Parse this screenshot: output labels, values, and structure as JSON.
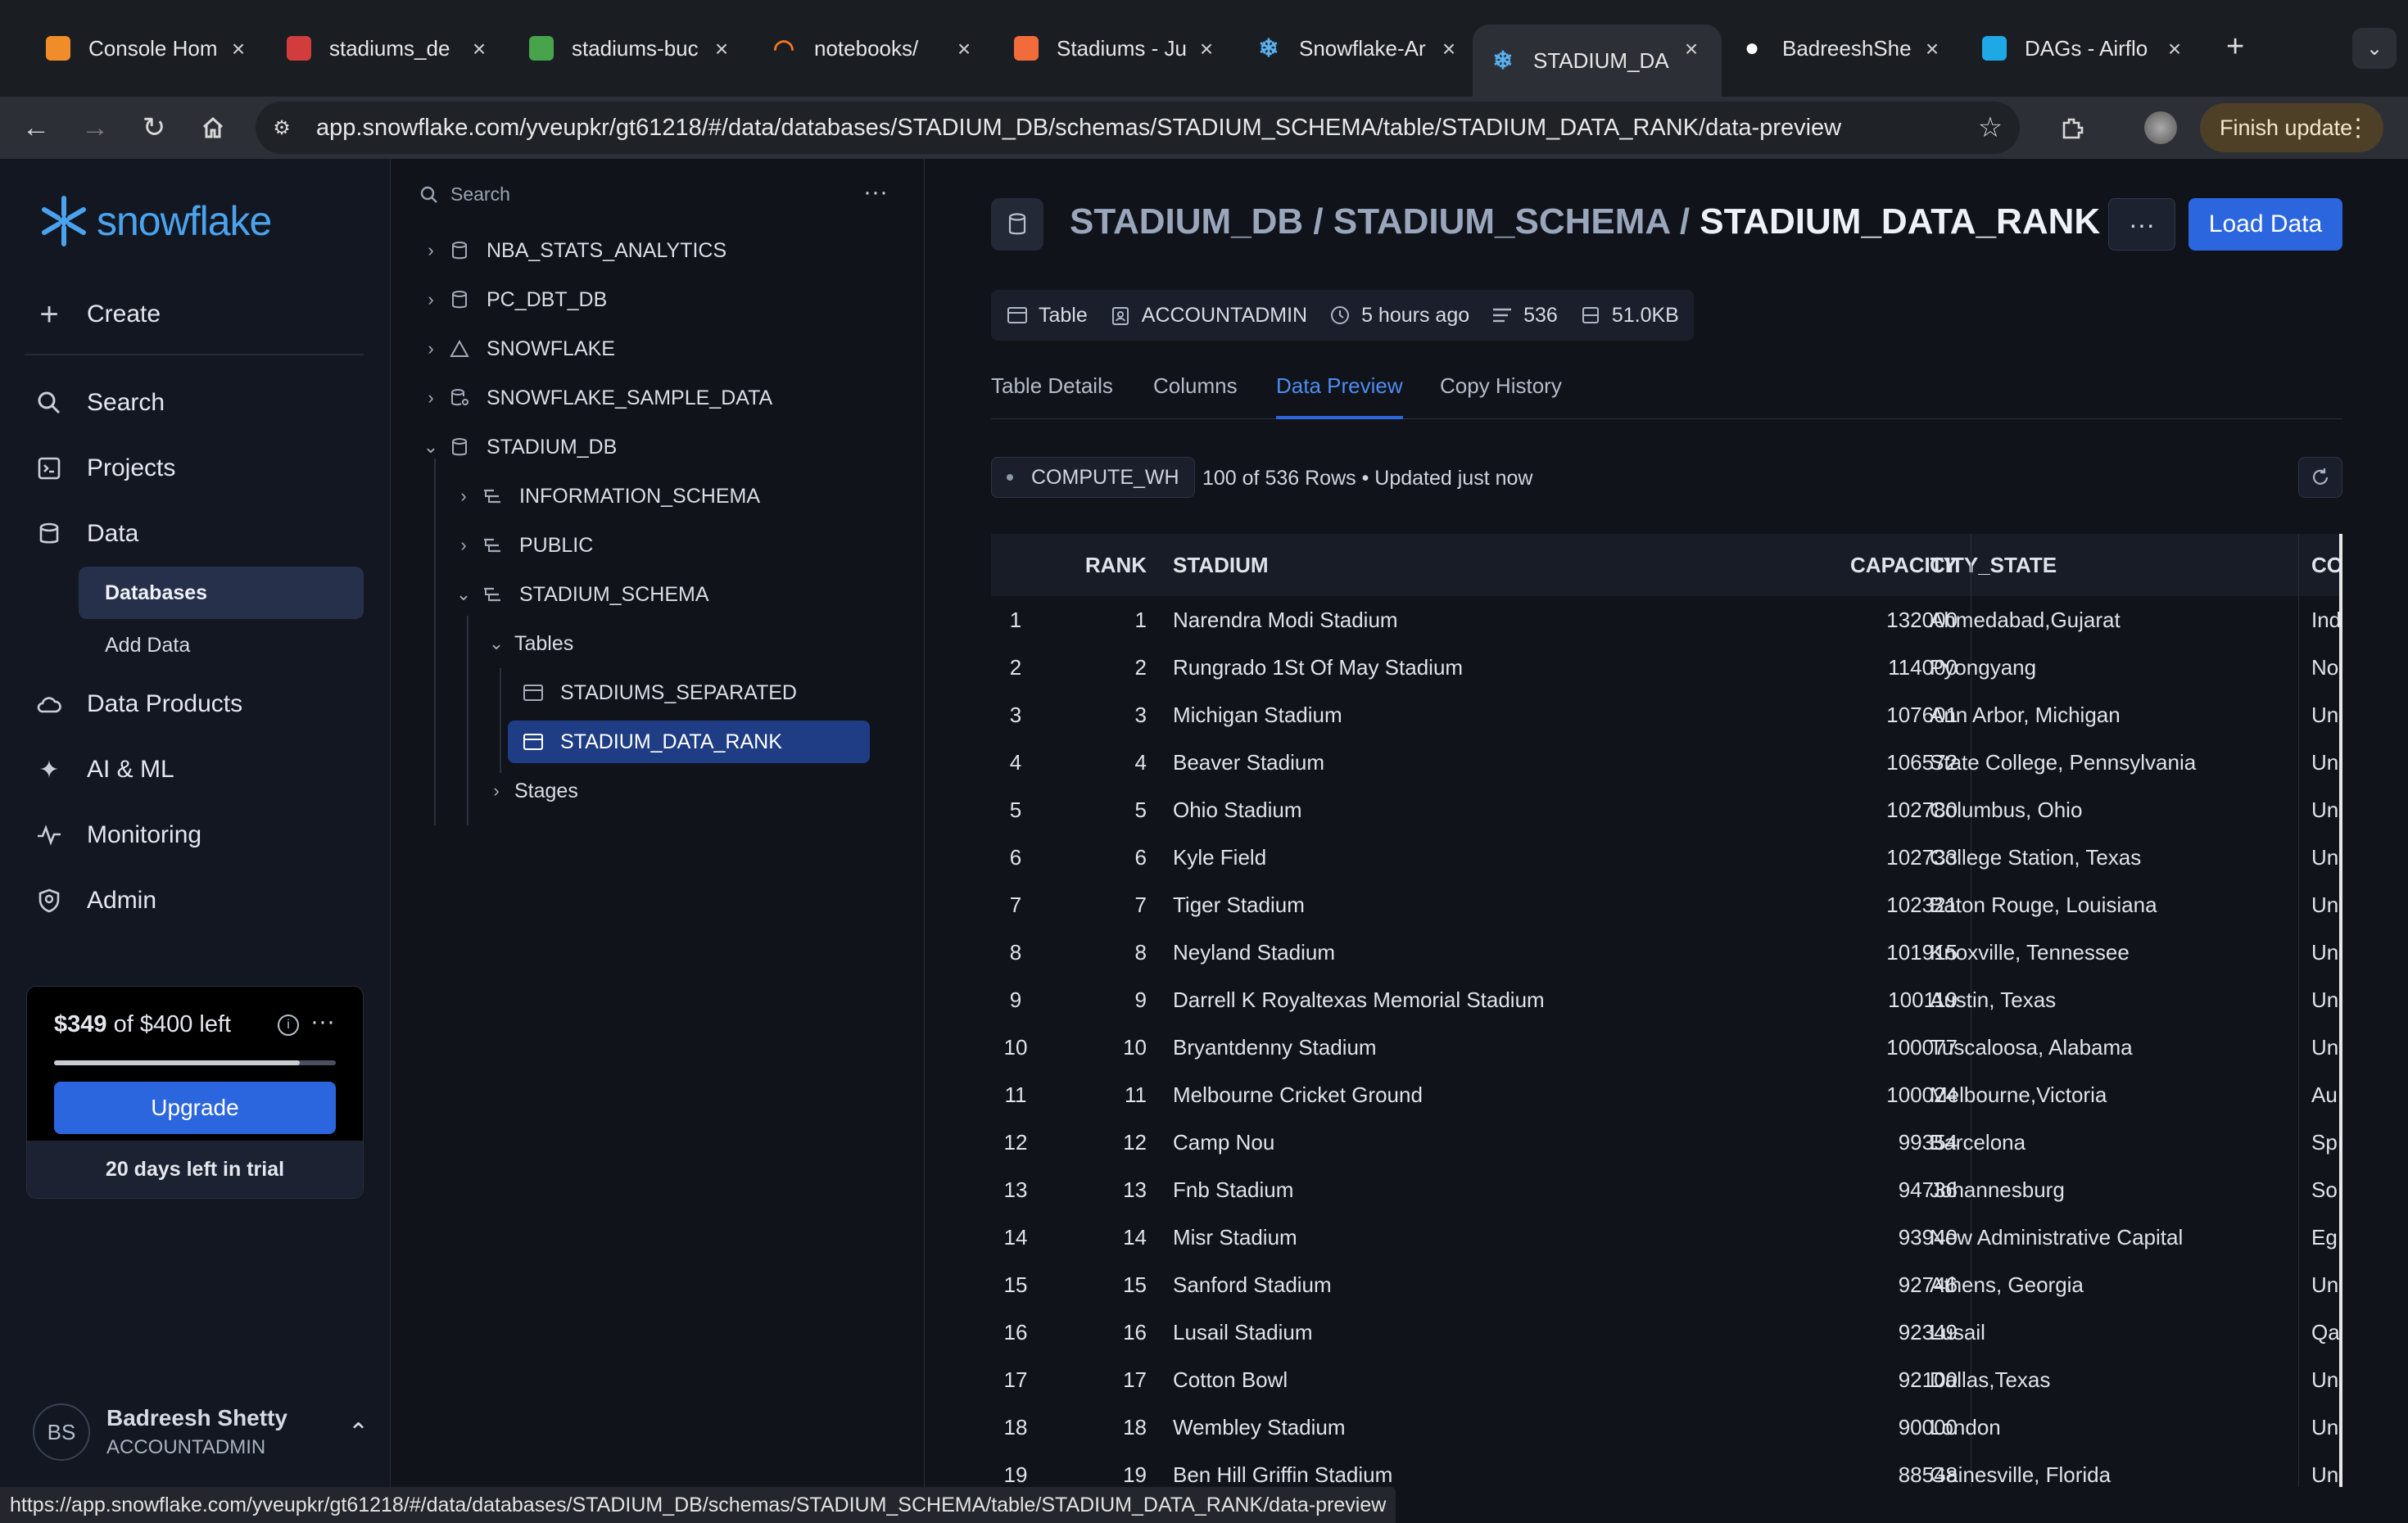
{
  "browser": {
    "tabs": [
      {
        "title": "Console Hom",
        "icon": "aws-icon",
        "color": "#f08c2a"
      },
      {
        "title": "stadiums_de",
        "icon": "app-icon",
        "color": "#d33c3c"
      },
      {
        "title": "stadiums-buc",
        "icon": "s3-icon",
        "color": "#48a44a"
      },
      {
        "title": "notebooks/",
        "icon": "jupyter-icon",
        "color": "#f37726"
      },
      {
        "title": "Stadiums - Ju",
        "icon": "book-icon",
        "color": "#f26b3a"
      },
      {
        "title": "Snowflake-Ar",
        "icon": "snowflake-icon",
        "color": "#5ab0f0"
      },
      {
        "title": "STADIUM_DA",
        "icon": "snowflake-icon",
        "color": "#5ab0f0"
      },
      {
        "title": "BadreeshShe",
        "icon": "github-icon",
        "color": "#ffffff"
      },
      {
        "title": "DAGs - Airflo",
        "icon": "airflow-icon",
        "color": "#1ea9e6"
      }
    ],
    "new_tab": "+",
    "url": "app.snowflake.com/yveupkr/gt61218/#/data/databases/STADIUM_DB/schemas/STADIUM_SCHEMA/table/STADIUM_DATA_RANK/data-preview",
    "finish_update": "Finish update",
    "status_url": "https://app.snowflake.com/yveupkr/gt61218/#/data/databases/STADIUM_DB/schemas/STADIUM_SCHEMA/table/STADIUM_DATA_RANK/data-preview"
  },
  "sidebar": {
    "logo": "snowflake",
    "create": "Create",
    "items": [
      {
        "label": "Search",
        "icon": "search-icon"
      },
      {
        "label": "Projects",
        "icon": "projects-icon"
      },
      {
        "label": "Data",
        "icon": "database-icon"
      },
      {
        "label": "Data Products",
        "icon": "cloud-icon"
      },
      {
        "label": "AI & ML",
        "icon": "sparkle-icon"
      },
      {
        "label": "Monitoring",
        "icon": "activity-icon"
      },
      {
        "label": "Admin",
        "icon": "shield-icon"
      }
    ],
    "sub_items": [
      "Databases",
      "Add Data"
    ],
    "credit": {
      "amount": "$349",
      "of_text": "of $400 left",
      "fill_fraction": 0.8725,
      "upgrade": "Upgrade",
      "trial": "20 days left in trial"
    },
    "user": {
      "initials": "BS",
      "name": "Badreesh Shetty",
      "role": "ACCOUNTADMIN"
    }
  },
  "tree": {
    "search_placeholder": "Search",
    "nodes": [
      {
        "label": "NBA_STATS_ANALYTICS"
      },
      {
        "label": "PC_DBT_DB"
      },
      {
        "label": "SNOWFLAKE"
      },
      {
        "label": "SNOWFLAKE_SAMPLE_DATA"
      },
      {
        "label": "STADIUM_DB"
      },
      {
        "label": "INFORMATION_SCHEMA"
      },
      {
        "label": "PUBLIC"
      },
      {
        "label": "STADIUM_SCHEMA"
      },
      {
        "label": "Tables"
      },
      {
        "label": "STADIUMS_SEPARATED"
      },
      {
        "label": "STADIUM_DATA_RANK"
      },
      {
        "label": "Stages"
      }
    ]
  },
  "main": {
    "title_db": "STADIUM_DB",
    "title_schema": "STADIUM_SCHEMA",
    "title_table": "STADIUM_DATA_RANK",
    "sep": "/",
    "load_data": "Load Data",
    "meta": {
      "type": "Table",
      "owner": "ACCOUNTADMIN",
      "updated": "5 hours ago",
      "rows": "536",
      "size": "51.0KB"
    },
    "tabs": [
      "Table Details",
      "Columns",
      "Data Preview",
      "Copy History"
    ],
    "warehouse": "COMPUTE_WH",
    "row_info": "100 of 536 Rows • Updated just now",
    "columns": [
      "RANK",
      "STADIUM",
      "CAPACITY",
      "CITY_STATE",
      "CO"
    ],
    "rows": [
      [
        "1",
        "1",
        "Narendra Modi Stadium",
        "132000",
        "Ahmedabad,Gujarat",
        "Ind"
      ],
      [
        "2",
        "2",
        "Rungrado 1St Of May Stadium",
        "114000",
        "Pyongyang",
        "No"
      ],
      [
        "3",
        "3",
        "Michigan Stadium",
        "107601",
        "Ann Arbor, Michigan",
        "Un"
      ],
      [
        "4",
        "4",
        "Beaver Stadium",
        "106572",
        "State College, Pennsylvania",
        "Un"
      ],
      [
        "5",
        "5",
        "Ohio Stadium",
        "102780",
        "Columbus, Ohio",
        "Un"
      ],
      [
        "6",
        "6",
        "Kyle Field",
        "102733",
        "College Station, Texas",
        "Un"
      ],
      [
        "7",
        "7",
        "Tiger Stadium",
        "102321",
        "Baton Rouge, Louisiana",
        "Un"
      ],
      [
        "8",
        "8",
        "Neyland Stadium",
        "101915",
        "Knoxville, Tennessee",
        "Un"
      ],
      [
        "9",
        "9",
        "Darrell K Royaltexas Memorial Stadium",
        "100119",
        "Austin, Texas",
        "Un"
      ],
      [
        "10",
        "10",
        "Bryantdenny Stadium",
        "100077",
        "Tuscaloosa, Alabama",
        "Un"
      ],
      [
        "11",
        "11",
        "Melbourne Cricket Ground",
        "100024",
        "Melbourne,Victoria",
        "Au"
      ],
      [
        "12",
        "12",
        "Camp Nou",
        "99354",
        "Barcelona",
        "Sp"
      ],
      [
        "13",
        "13",
        "Fnb Stadium",
        "94736",
        "Johannesburg",
        "So"
      ],
      [
        "14",
        "14",
        "Misr Stadium",
        "93940",
        "New Administrative Capital",
        "Eg"
      ],
      [
        "15",
        "15",
        "Sanford Stadium",
        "92746",
        "Athens, Georgia",
        "Un"
      ],
      [
        "16",
        "16",
        "Lusail Stadium",
        "92349",
        "Lusail",
        "Qa"
      ],
      [
        "17",
        "17",
        "Cotton Bowl",
        "92100",
        "Dallas,Texas",
        "Un"
      ],
      [
        "18",
        "18",
        "Wembley Stadium",
        "90000",
        "London",
        "Un"
      ],
      [
        "19",
        "19",
        "Ben Hill Griffin Stadium",
        "88548",
        "Gainesville, Florida",
        "Un"
      ]
    ]
  },
  "colors": {
    "accent": "#2b66df",
    "selected_node": "#1f3d85",
    "active_tab_text": "#4e8cf0"
  }
}
